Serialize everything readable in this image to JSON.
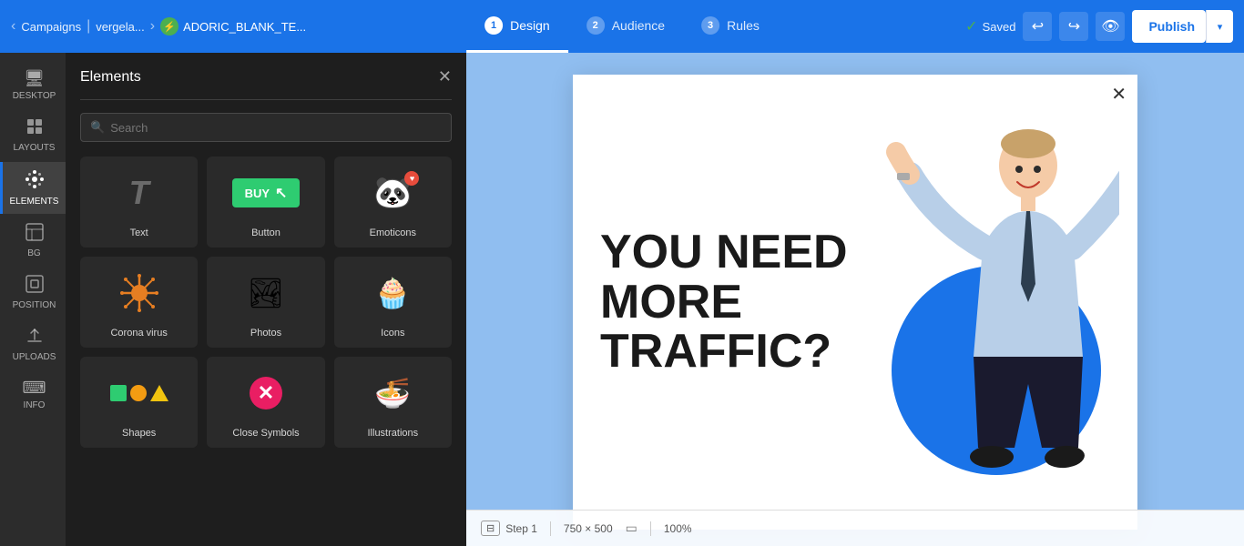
{
  "topbar": {
    "campaigns_label": "Campaigns",
    "breadcrumb_vergela": "vergela...",
    "breadcrumb_adoric": "ADORIC_BLANK_TE...",
    "nav_tabs": [
      {
        "num": "1",
        "label": "Design",
        "active": true
      },
      {
        "num": "2",
        "label": "Audience",
        "active": false
      },
      {
        "num": "3",
        "label": "Rules",
        "active": false
      }
    ],
    "saved_label": "Saved",
    "publish_label": "Publish"
  },
  "sidebar": {
    "items": [
      {
        "id": "desktop",
        "icon": "🖥",
        "label": "DESKTOP"
      },
      {
        "id": "layouts",
        "icon": "⊞",
        "label": "LAYOUTS"
      },
      {
        "id": "elements",
        "icon": "✦",
        "label": "ELEMENTS",
        "active": true
      },
      {
        "id": "bg",
        "icon": "▦",
        "label": "BG"
      },
      {
        "id": "position",
        "icon": "⊡",
        "label": "POSITION"
      },
      {
        "id": "uploads",
        "icon": "↑",
        "label": "UPLOADS"
      },
      {
        "id": "info",
        "icon": "⌨",
        "label": "INFO"
      }
    ]
  },
  "elements_panel": {
    "title": "Elements",
    "search_placeholder": "Search",
    "cards": [
      {
        "id": "text",
        "label": "Text"
      },
      {
        "id": "button",
        "label": "Button"
      },
      {
        "id": "emoticons",
        "label": "Emoticons"
      },
      {
        "id": "coronavirus",
        "label": "Corona virus"
      },
      {
        "id": "photos",
        "label": "Photos"
      },
      {
        "id": "icons",
        "label": "Icons"
      },
      {
        "id": "shapes",
        "label": "Shapes"
      },
      {
        "id": "close-symbols",
        "label": "Close Symbols"
      },
      {
        "id": "illustrations",
        "label": "Illustrations"
      }
    ]
  },
  "canvas": {
    "headline_line1": "YOU NEED",
    "headline_line2": "MORE TRAFFIC?",
    "close_label": "×"
  },
  "bottom_bar": {
    "step_label": "Step 1",
    "dimensions": "750 × 500",
    "zoom": "100%"
  },
  "colors": {
    "accent_blue": "#1a73e8",
    "topbar_bg": "#1a73e8",
    "sidebar_bg": "#2c2c2c",
    "panel_bg": "#1e1e1e",
    "canvas_bg": "#90bef0"
  }
}
